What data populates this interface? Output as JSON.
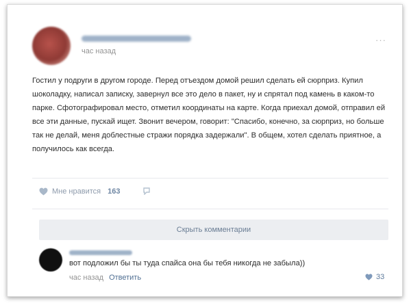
{
  "post": {
    "time": "час назад",
    "more": "···",
    "text": "Гостил у подруги в другом городе. Перед отъездом домой решил сделать ей сюрприз. Купил шоколадку, написал записку, завернул все это дело в пакет, ну и спрятал под камень в каком-то парке. Сфотографировал место, отметил координаты на карте. Когда приехал домой, отправил ей все эти данные, пускай ищет. Звонит вечером, говорит: \"Спасибо, конечно, за сюрприз, но больше так не делай, меня доблестные стражи порядка задержали\". В общем, хотел сделать приятное, а получилось как всегда.",
    "like_label": "Мне нравится",
    "like_count": "163"
  },
  "comments": {
    "hide_label": "Скрыть комментарии",
    "items": [
      {
        "text": "вот подложил бы ты туда спайса она бы тебя никогда не забыла))",
        "time": "час назад",
        "reply_label": "Ответить",
        "likes": "33"
      }
    ]
  },
  "colors": {
    "accent": "#6e86a3",
    "button_bg": "#eceef1",
    "muted_text": "#939393"
  }
}
